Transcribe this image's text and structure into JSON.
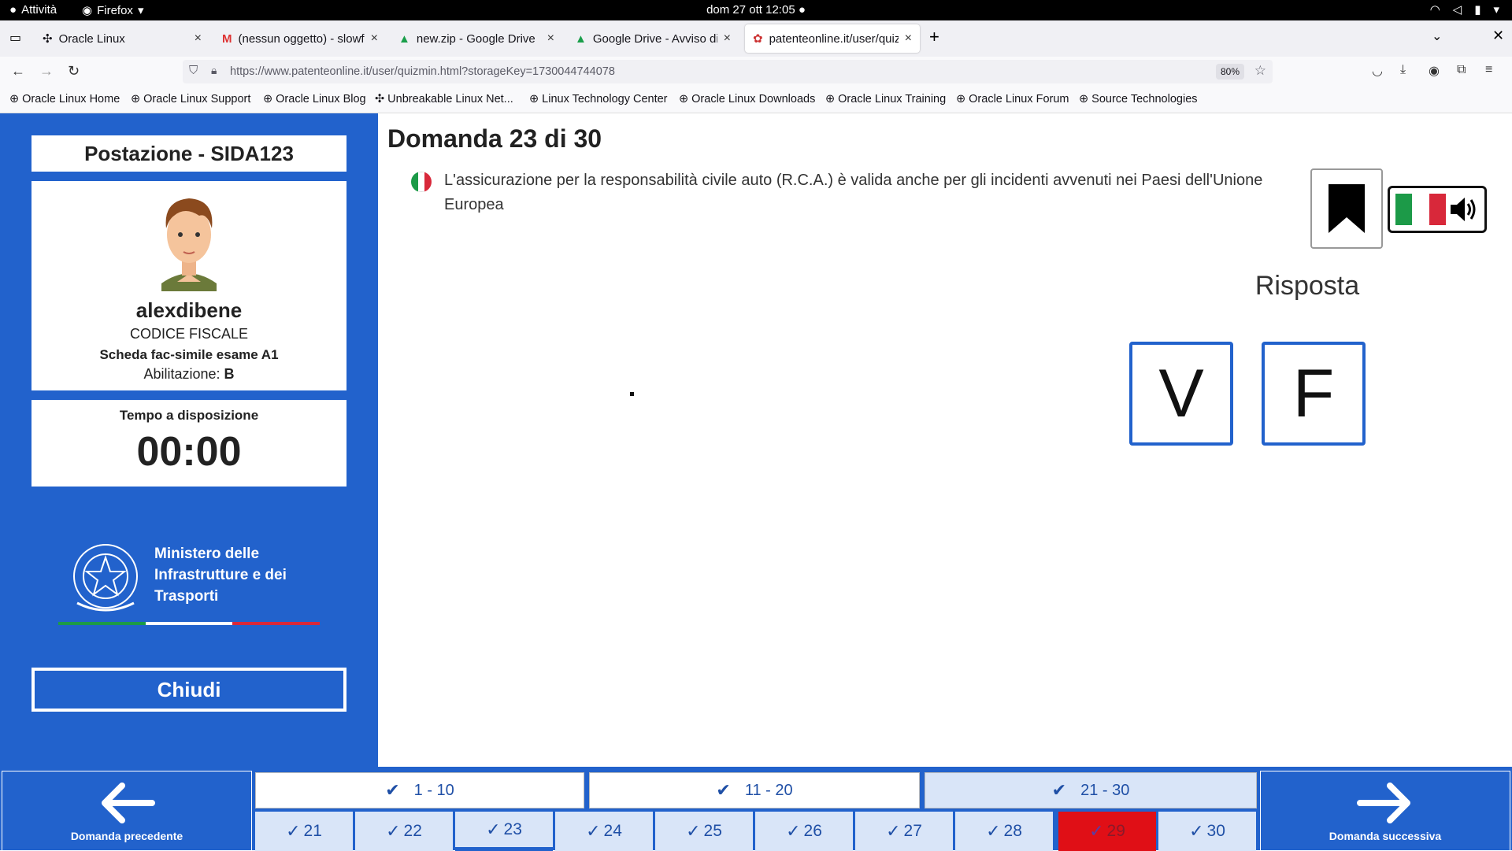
{
  "os": {
    "activities": "Attività",
    "app": "Firefox",
    "clock": "dom 27 ott 12:05"
  },
  "tabs": [
    {
      "title": "Oracle Linux"
    },
    {
      "title": "(nessun oggetto) - slowfo"
    },
    {
      "title": "new.zip - Google Drive"
    },
    {
      "title": "Google Drive - Avviso di s"
    },
    {
      "title": "patenteonline.it/user/quiz"
    }
  ],
  "url": "https://www.patenteonline.it/user/quizmin.html?storageKey=1730044744078",
  "zoom": "80%",
  "bookmarks": [
    "Oracle Linux Home",
    "Oracle Linux Support",
    "Oracle Linux Blog",
    "Unbreakable Linux Net...",
    "Linux Technology Center",
    "Oracle Linux Downloads",
    "Oracle Linux Training",
    "Oracle Linux Forum",
    "Source Technologies"
  ],
  "sidebar": {
    "station": "Postazione - SIDA123",
    "username": "alexdibene",
    "codice_fiscale": "CODICE FISCALE",
    "scheda": "Scheda fac-simile esame A1",
    "abilitazione_label": "Abilitazione: ",
    "abilitazione_value": "B",
    "timer_label": "Tempo a disposizione",
    "timer_value": "00:00",
    "ministry_line1": "Ministero delle",
    "ministry_line2": "Infrastrutture e dei",
    "ministry_line3": "Trasporti",
    "close_label": "Chiudi"
  },
  "question": {
    "title": "Domanda 23 di 30",
    "text": "L'assicurazione per la responsabilità civile auto (R.C.A.) è valida anche per gli incidenti avvenuti nei Paesi dell'Unione Europea",
    "answer_label": "Risposta",
    "true_label": "V",
    "false_label": "F"
  },
  "bottom": {
    "prev_label": "Domanda precedente",
    "next_label": "Domanda successiva",
    "ranges": [
      "1 - 10",
      "11 - 20",
      "21 - 30"
    ],
    "numbers": [
      "21",
      "22",
      "23",
      "24",
      "25",
      "26",
      "27",
      "28",
      "29",
      "30"
    ]
  },
  "colors": {
    "primary": "#2262cc",
    "wrong": "#e00f16"
  }
}
